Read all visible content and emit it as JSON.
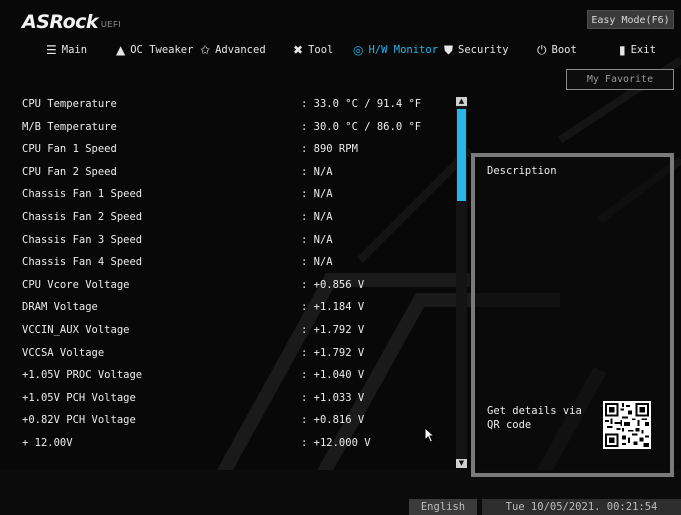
{
  "header": {
    "brand_logo": "ASRock",
    "brand_sub": "UEFI",
    "easy_mode": "Easy Mode(F6)"
  },
  "tabs": [
    {
      "label": "Main",
      "icon": "list-icon"
    },
    {
      "label": "OC Tweaker",
      "icon": "rocket-icon"
    },
    {
      "label": "Advanced",
      "icon": "star-icon"
    },
    {
      "label": "Tool",
      "icon": "tool-icon"
    },
    {
      "label": "H/W Monitor",
      "icon": "monitor-icon",
      "active": true
    },
    {
      "label": "Security",
      "icon": "shield-icon"
    },
    {
      "label": "Boot",
      "icon": "power-icon"
    },
    {
      "label": "Exit",
      "icon": "exit-icon"
    }
  ],
  "my_favorite": "My Favorite",
  "sensors": [
    {
      "label": "CPU Temperature",
      "value": ": 33.0 °C /  91.4 °F"
    },
    {
      "label": "M/B Temperature",
      "value": ": 30.0 °C /  86.0 °F"
    },
    {
      "label": "CPU Fan 1 Speed",
      "value": ": 890 RPM"
    },
    {
      "label": "CPU Fan 2 Speed",
      "value": ": N/A"
    },
    {
      "label": "Chassis Fan 1 Speed",
      "value": ": N/A"
    },
    {
      "label": "Chassis Fan 2 Speed",
      "value": ": N/A"
    },
    {
      "label": "Chassis Fan 3 Speed",
      "value": ": N/A"
    },
    {
      "label": "Chassis Fan 4 Speed",
      "value": ": N/A"
    },
    {
      "label": "CPU Vcore Voltage",
      "value": ": +0.856 V"
    },
    {
      "label": "DRAM Voltage",
      "value": ": +1.184 V"
    },
    {
      "label": "VCCIN_AUX Voltage",
      "value": ": +1.792 V"
    },
    {
      "label": "VCCSA Voltage",
      "value": ": +1.792 V"
    },
    {
      "label": "+1.05V PROC Voltage",
      "value": ": +1.040 V"
    },
    {
      "label": "+1.05V PCH Voltage",
      "value": ": +1.033 V"
    },
    {
      "label": "+0.82V PCH Voltage",
      "value": ": +0.816 V"
    },
    {
      "label": "+ 12.00V",
      "value": ": +12.000 V"
    }
  ],
  "description": {
    "title": "Description",
    "qr_text": "Get details via QR code"
  },
  "footer": {
    "language": "English",
    "datetime": "Tue 10/05/2021. 00:21:54"
  },
  "colors": {
    "accent": "#27b6ec",
    "background": "#080808",
    "panel_border": "#7a7a7a"
  }
}
